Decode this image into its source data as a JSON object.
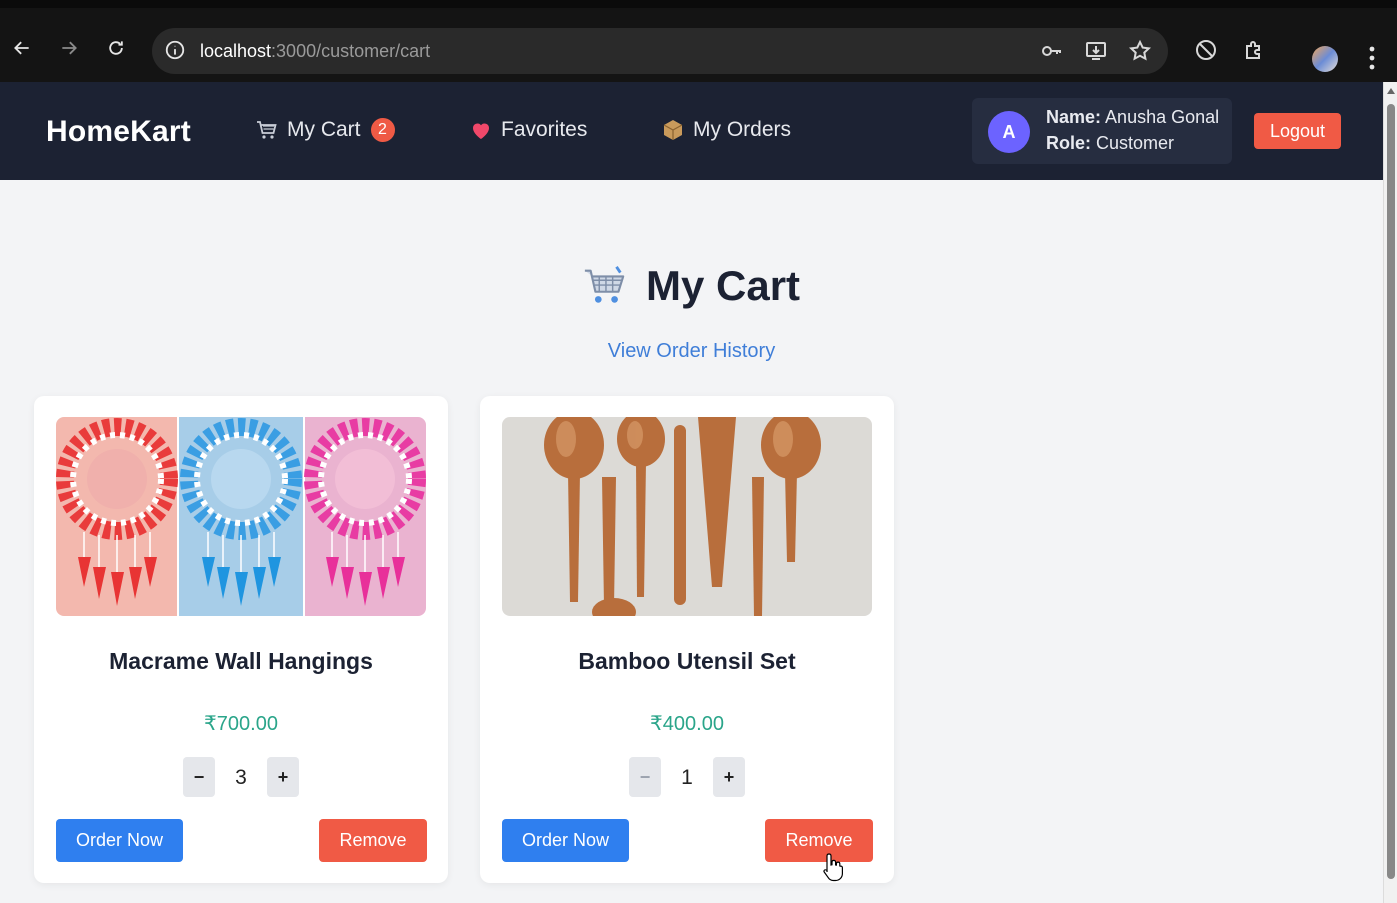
{
  "browser": {
    "url_host": "localhost",
    "url_path": ":3000/customer/cart"
  },
  "navbar": {
    "brand": "HomeKart",
    "links": [
      {
        "label": "My Cart",
        "badge": "2"
      },
      {
        "label": "Favorites"
      },
      {
        "label": "My Orders"
      }
    ],
    "user": {
      "avatar_letter": "A",
      "name_label": "Name:",
      "name_value": "Anusha Gonal",
      "role_label": "Role:",
      "role_value": "Customer"
    },
    "logout_label": "Logout"
  },
  "page": {
    "title": "My Cart",
    "history_link": "View Order History"
  },
  "cart_items": [
    {
      "name": "Macrame Wall Hangings",
      "price": "₹700.00",
      "quantity": "3",
      "minus": "−",
      "plus": "+",
      "order_label": "Order Now",
      "remove_label": "Remove"
    },
    {
      "name": "Bamboo Utensil Set",
      "price": "₹400.00",
      "quantity": "1",
      "minus": "−",
      "plus": "+",
      "order_label": "Order Now",
      "remove_label": "Remove"
    }
  ],
  "colors": {
    "navbar_bg": "#1c2233",
    "accent_blue": "#2f7fef",
    "accent_red": "#f05a45",
    "price_green": "#2aa58a",
    "link_blue": "#3f7ed8"
  }
}
